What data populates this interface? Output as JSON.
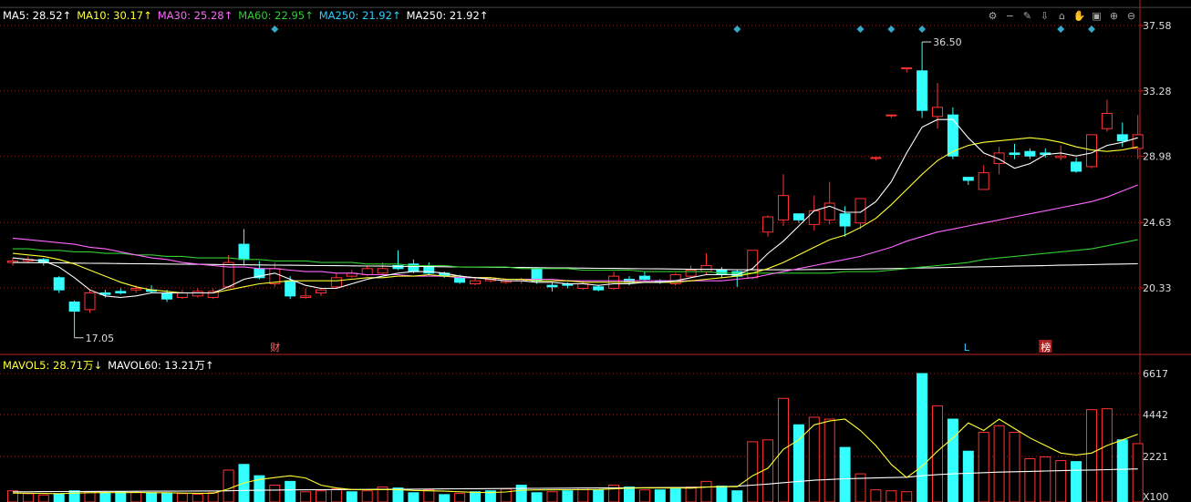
{
  "ma_legend": [
    {
      "text": "MA5: 28.52↑",
      "color": "#ffffff"
    },
    {
      "text": "MA10: 30.17↑",
      "color": "#ffff33"
    },
    {
      "text": "MA30: 25.28↑",
      "color": "#ff66ff"
    },
    {
      "text": "MA60: 22.95↑",
      "color": "#33cc33"
    },
    {
      "text": "MA250: 21.92↑",
      "color": "#33ccff"
    },
    {
      "text": "MA250: 21.92↑",
      "color": "#ffffff"
    }
  ],
  "vol_legend": [
    {
      "text": "MAVOL5: 28.71万↓",
      "color": "#ffff33"
    },
    {
      "text": "MAVOL60: 13.21万↑",
      "color": "#ffffff"
    }
  ],
  "toolbar_icons": [
    "settings-icon",
    "minus-icon",
    "brush-icon",
    "download-icon",
    "home-icon",
    "hand-icon",
    "lock-icon",
    "zoom-in-icon",
    "zoom-out-icon"
  ],
  "toolbar_glyphs": [
    "⚙",
    "−",
    "✎",
    "⇩",
    "⌂",
    "✋",
    "▣",
    "⊕",
    "⊖"
  ],
  "chart_data": {
    "type": "candlestick",
    "price_axis": {
      "ticks": [
        "37.58",
        "33.28",
        "28.98",
        "24.63",
        "20.33"
      ],
      "ylim": [
        17.0,
        37.58
      ]
    },
    "volume_axis": {
      "ticks": [
        "6617",
        "4442",
        "2221"
      ],
      "unit_label": "X100",
      "ylim": [
        0,
        7000
      ]
    },
    "annotations": {
      "high": "36.50",
      "low": "17.05"
    },
    "markers": [
      {
        "label": "财",
        "x_index": 17,
        "color": "#ff6666",
        "boxed": false
      },
      {
        "label": "L",
        "x_index": 62,
        "color": "#33ccff",
        "boxed": false
      },
      {
        "label": "榜",
        "x_index": 67,
        "color": "#ffffff",
        "boxed": true
      }
    ],
    "diamond_markers_x_index": [
      17,
      47,
      55,
      57,
      59,
      68,
      70
    ],
    "colors": {
      "up": "#ff3333",
      "down": "#33ffff",
      "ma5": "#ffffff",
      "ma10": "#ffff33",
      "ma30": "#ff66ff",
      "ma60": "#33cc33",
      "ma250": "#ffffff",
      "vol_ma5": "#ffff33",
      "vol_ma60": "#ffffff"
    },
    "candles": [
      [
        22.0,
        22.1,
        21.8,
        22.3
      ],
      [
        22.1,
        22.2,
        22.0,
        22.4
      ],
      [
        22.2,
        22.0,
        21.8,
        22.3
      ],
      [
        21.0,
        20.2,
        20.0,
        21.1
      ],
      [
        19.4,
        18.8,
        17.05,
        19.5
      ],
      [
        18.9,
        20.0,
        18.7,
        20.2
      ],
      [
        20.0,
        19.9,
        19.7,
        20.2
      ],
      [
        20.1,
        20.0,
        19.9,
        20.3
      ],
      [
        20.2,
        20.3,
        20.0,
        20.5
      ],
      [
        20.2,
        20.1,
        20.0,
        20.5
      ],
      [
        20.0,
        19.6,
        19.4,
        20.2
      ],
      [
        19.7,
        20.0,
        19.6,
        20.2
      ],
      [
        19.8,
        20.1,
        19.7,
        20.3
      ],
      [
        19.7,
        20.1,
        19.6,
        20.3
      ],
      [
        20.4,
        22.0,
        20.3,
        22.5
      ],
      [
        23.2,
        22.2,
        21.8,
        24.2
      ],
      [
        21.6,
        21.0,
        20.9,
        22.1
      ],
      [
        20.6,
        21.6,
        20.4,
        22.0
      ],
      [
        20.8,
        19.8,
        19.6,
        21.1
      ],
      [
        19.7,
        19.8,
        19.6,
        20.3
      ],
      [
        20.0,
        20.2,
        19.8,
        20.3
      ],
      [
        20.4,
        21.0,
        20.3,
        21.3
      ],
      [
        21.1,
        21.3,
        21.0,
        21.5
      ],
      [
        21.2,
        21.6,
        21.1,
        21.8
      ],
      [
        21.3,
        21.6,
        21.2,
        22.0
      ],
      [
        21.8,
        21.6,
        21.5,
        22.8
      ],
      [
        21.9,
        21.4,
        21.3,
        22.2
      ],
      [
        21.8,
        21.3,
        21.2,
        22.0
      ],
      [
        21.3,
        21.1,
        21.0,
        21.4
      ],
      [
        21.0,
        20.7,
        20.6,
        21.2
      ],
      [
        20.6,
        20.8,
        20.5,
        21.0
      ],
      [
        20.8,
        20.9,
        20.7,
        21.0
      ],
      [
        20.7,
        20.8,
        20.6,
        20.9
      ],
      [
        20.8,
        20.9,
        20.6,
        21.0
      ],
      [
        21.6,
        20.8,
        20.6,
        21.7
      ],
      [
        20.5,
        20.4,
        20.1,
        20.7
      ],
      [
        20.6,
        20.5,
        20.3,
        20.7
      ],
      [
        20.3,
        20.6,
        20.2,
        20.8
      ],
      [
        20.4,
        20.2,
        20.1,
        20.5
      ],
      [
        20.3,
        21.1,
        20.2,
        21.4
      ],
      [
        20.9,
        20.7,
        20.5,
        21.1
      ],
      [
        21.1,
        20.9,
        20.8,
        21.4
      ],
      [
        20.8,
        20.7,
        20.6,
        20.9
      ],
      [
        20.6,
        21.2,
        20.5,
        21.3
      ],
      [
        21.1,
        21.5,
        21.0,
        21.8
      ],
      [
        21.4,
        21.8,
        21.2,
        22.6
      ],
      [
        21.5,
        21.2,
        21.0,
        21.7
      ],
      [
        21.4,
        21.1,
        20.4,
        21.5
      ],
      [
        21.0,
        22.8,
        20.9,
        22.8
      ],
      [
        24.0,
        25.0,
        23.7,
        25.1
      ],
      [
        24.8,
        26.4,
        24.4,
        27.8
      ],
      [
        25.2,
        24.8,
        24.6,
        25.2
      ],
      [
        24.5,
        25.4,
        24.1,
        26.4
      ],
      [
        24.8,
        25.9,
        24.5,
        27.3
      ],
      [
        25.2,
        24.4,
        23.7,
        25.7
      ],
      [
        24.6,
        26.2,
        24.2,
        26.2
      ],
      [
        28.9,
        28.9,
        28.7,
        28.9
      ],
      [
        31.7,
        31.7,
        31.5,
        31.7
      ],
      [
        34.8,
        34.8,
        34.5,
        34.8
      ],
      [
        34.6,
        32.0,
        31.5,
        36.5
      ],
      [
        31.6,
        32.2,
        30.8,
        33.8
      ],
      [
        31.7,
        29.0,
        28.8,
        32.2
      ],
      [
        27.6,
        27.4,
        27.1,
        27.6
      ],
      [
        26.8,
        27.9,
        26.8,
        28.4
      ],
      [
        28.5,
        29.2,
        27.8,
        29.6
      ],
      [
        29.2,
        29.1,
        28.8,
        29.8
      ],
      [
        29.3,
        29.0,
        28.8,
        29.5
      ],
      [
        29.2,
        29.1,
        28.9,
        29.5
      ],
      [
        28.9,
        29.0,
        28.7,
        29.7
      ],
      [
        28.6,
        28.0,
        27.9,
        28.9
      ],
      [
        28.3,
        30.4,
        28.2,
        30.4
      ],
      [
        30.8,
        31.8,
        30.6,
        32.7
      ],
      [
        30.4,
        30.0,
        29.6,
        31.2
      ],
      [
        29.5,
        30.4,
        28.8,
        31.7
      ]
    ],
    "volume": [
      [
        400,
        1
      ],
      [
        250,
        1
      ],
      [
        180,
        1
      ],
      [
        220,
        0
      ],
      [
        400,
        0
      ],
      [
        350,
        1
      ],
      [
        280,
        0
      ],
      [
        350,
        0
      ],
      [
        320,
        1
      ],
      [
        300,
        0
      ],
      [
        280,
        0
      ],
      [
        250,
        1
      ],
      [
        220,
        1
      ],
      [
        300,
        1
      ],
      [
        1500,
        1
      ],
      [
        1800,
        0
      ],
      [
        1200,
        0
      ],
      [
        700,
        1
      ],
      [
        900,
        0
      ],
      [
        350,
        1
      ],
      [
        400,
        1
      ],
      [
        500,
        1
      ],
      [
        350,
        0
      ],
      [
        400,
        1
      ],
      [
        600,
        1
      ],
      [
        550,
        0
      ],
      [
        300,
        0
      ],
      [
        450,
        1
      ],
      [
        200,
        0
      ],
      [
        260,
        1
      ],
      [
        350,
        0
      ],
      [
        400,
        0
      ],
      [
        500,
        1
      ],
      [
        700,
        0
      ],
      [
        300,
        0
      ],
      [
        350,
        1
      ],
      [
        400,
        0
      ],
      [
        550,
        1
      ],
      [
        450,
        0
      ],
      [
        700,
        1
      ],
      [
        600,
        0
      ],
      [
        450,
        1
      ],
      [
        450,
        0
      ],
      [
        500,
        0
      ],
      [
        600,
        1
      ],
      [
        900,
        1
      ],
      [
        650,
        0
      ],
      [
        400,
        0
      ],
      [
        3000,
        1
      ],
      [
        3100,
        1
      ],
      [
        5300,
        1
      ],
      [
        3900,
        0
      ],
      [
        4300,
        1
      ],
      [
        4200,
        1
      ],
      [
        2700,
        0
      ],
      [
        1300,
        1
      ],
      [
        450,
        1
      ],
      [
        400,
        1
      ],
      [
        350,
        1
      ],
      [
        6617,
        0
      ],
      [
        4900,
        1
      ],
      [
        4200,
        0
      ],
      [
        2500,
        0
      ],
      [
        3500,
        1
      ],
      [
        3850,
        1
      ],
      [
        3500,
        1
      ],
      [
        2100,
        1
      ],
      [
        2200,
        1
      ],
      [
        2000,
        1
      ],
      [
        1950,
        0
      ],
      [
        4700,
        1
      ],
      [
        4750,
        1
      ],
      [
        3100,
        0
      ],
      [
        2900,
        1
      ]
    ],
    "ma5": [
      22.3,
      22.2,
      22.1,
      21.7,
      21.0,
      20.2,
      19.8,
      19.7,
      19.8,
      20.0,
      20.0,
      20.0,
      20.0,
      20.0,
      20.4,
      20.9,
      21.1,
      21.3,
      20.9,
      20.5,
      20.3,
      20.3,
      20.6,
      20.9,
      21.1,
      21.3,
      21.4,
      21.4,
      21.3,
      21.1,
      21.0,
      20.9,
      20.8,
      20.8,
      20.7,
      20.7,
      20.6,
      20.6,
      20.5,
      20.6,
      20.6,
      20.7,
      20.7,
      20.8,
      21.0,
      21.2,
      21.2,
      21.2,
      21.6,
      22.6,
      23.4,
      24.4,
      25.4,
      25.7,
      25.3,
      25.3,
      26.0,
      27.3,
      29.2,
      30.9,
      31.4,
      31.4,
      30.2,
      29.2,
      28.8,
      28.2,
      28.5,
      29.1,
      29.2,
      29.0,
      29.2,
      29.7,
      29.9,
      30.2
    ],
    "ma10": [
      22.6,
      22.5,
      22.4,
      22.2,
      21.9,
      21.5,
      21.1,
      20.7,
      20.4,
      20.2,
      20.1,
      20.0,
      20.0,
      20.0,
      20.2,
      20.4,
      20.6,
      20.7,
      20.8,
      20.8,
      20.8,
      20.8,
      20.9,
      21.0,
      21.0,
      21.1,
      21.1,
      21.2,
      21.1,
      21.1,
      21.0,
      21.0,
      20.9,
      20.9,
      20.8,
      20.8,
      20.8,
      20.7,
      20.7,
      20.7,
      20.7,
      20.7,
      20.7,
      20.7,
      20.8,
      20.9,
      21.0,
      21.1,
      21.3,
      21.6,
      22.0,
      22.5,
      23.0,
      23.5,
      23.8,
      24.3,
      24.9,
      25.8,
      26.8,
      27.8,
      28.7,
      29.3,
      29.7,
      29.9,
      30.0,
      30.1,
      30.2,
      30.1,
      29.9,
      29.6,
      29.4,
      29.3,
      29.4,
      29.6
    ],
    "ma30": [
      23.6,
      23.5,
      23.4,
      23.3,
      23.2,
      23.0,
      22.9,
      22.7,
      22.5,
      22.3,
      22.2,
      22.0,
      21.9,
      21.8,
      21.7,
      21.7,
      21.6,
      21.6,
      21.5,
      21.4,
      21.4,
      21.3,
      21.3,
      21.2,
      21.2,
      21.2,
      21.1,
      21.1,
      21.1,
      21.0,
      21.0,
      21.0,
      20.9,
      20.9,
      20.9,
      20.9,
      20.8,
      20.8,
      20.8,
      20.8,
      20.8,
      20.8,
      20.8,
      20.8,
      20.8,
      20.8,
      20.8,
      20.9,
      21.0,
      21.2,
      21.4,
      21.6,
      21.8,
      22.0,
      22.2,
      22.4,
      22.7,
      23.0,
      23.4,
      23.7,
      24.0,
      24.2,
      24.4,
      24.6,
      24.8,
      25.0,
      25.2,
      25.4,
      25.6,
      25.8,
      26.0,
      26.3,
      26.7,
      27.1
    ],
    "ma60": [
      22.9,
      22.9,
      22.8,
      22.8,
      22.7,
      22.7,
      22.6,
      22.6,
      22.5,
      22.5,
      22.4,
      22.4,
      22.3,
      22.3,
      22.3,
      22.2,
      22.2,
      22.1,
      22.1,
      22.1,
      22.0,
      22.0,
      22.0,
      21.9,
      21.9,
      21.9,
      21.8,
      21.8,
      21.8,
      21.7,
      21.7,
      21.7,
      21.7,
      21.6,
      21.6,
      21.6,
      21.6,
      21.5,
      21.5,
      21.5,
      21.5,
      21.4,
      21.4,
      21.4,
      21.4,
      21.4,
      21.3,
      21.3,
      21.3,
      21.3,
      21.3,
      21.3,
      21.3,
      21.3,
      21.4,
      21.4,
      21.4,
      21.5,
      21.6,
      21.7,
      21.8,
      21.9,
      22.0,
      22.2,
      22.3,
      22.4,
      22.5,
      22.6,
      22.7,
      22.8,
      22.9,
      23.1,
      23.3,
      23.5
    ],
    "ma250": [
      22.0,
      21.99,
      21.98,
      21.97,
      21.96,
      21.95,
      21.94,
      21.93,
      21.92,
      21.91,
      21.9,
      21.89,
      21.88,
      21.87,
      21.86,
      21.85,
      21.84,
      21.83,
      21.82,
      21.81,
      21.8,
      21.79,
      21.78,
      21.77,
      21.76,
      21.75,
      21.74,
      21.73,
      21.72,
      21.71,
      21.7,
      21.69,
      21.68,
      21.67,
      21.66,
      21.65,
      21.64,
      21.63,
      21.62,
      21.61,
      21.6,
      21.59,
      21.58,
      21.57,
      21.56,
      21.55,
      21.54,
      21.53,
      21.52,
      21.52,
      21.52,
      21.53,
      21.54,
      21.55,
      21.56,
      21.57,
      21.58,
      21.6,
      21.62,
      21.64,
      21.66,
      21.68,
      21.7,
      21.72,
      21.74,
      21.76,
      21.78,
      21.8,
      21.82,
      21.84,
      21.86,
      21.88,
      21.9,
      21.92
    ],
    "vol_ma5": [
      280,
      270,
      260,
      250,
      280,
      300,
      310,
      300,
      320,
      300,
      300,
      280,
      270,
      270,
      500,
      820,
      1000,
      1100,
      1200,
      1080,
      700,
      550,
      470,
      460,
      470,
      460,
      420,
      400,
      380,
      350,
      320,
      310,
      340,
      430,
      450,
      450,
      460,
      460,
      470,
      500,
      540,
      560,
      550,
      560,
      540,
      600,
      620,
      620,
      1200,
      1600,
      2600,
      3100,
      3900,
      4100,
      4200,
      3600,
      2800,
      1800,
      1100,
      1700,
      2500,
      3200,
      4000,
      3600,
      4200,
      3700,
      3200,
      2800,
      2400,
      2300,
      2400,
      2800,
      3100,
      3400
    ],
    "vol_ma60": [
      350,
      350,
      355,
      360,
      360,
      365,
      370,
      370,
      375,
      380,
      380,
      385,
      390,
      390,
      400,
      420,
      430,
      440,
      450,
      455,
      460,
      465,
      470,
      475,
      480,
      485,
      490,
      495,
      500,
      505,
      510,
      515,
      520,
      525,
      530,
      535,
      540,
      545,
      550,
      555,
      560,
      565,
      570,
      575,
      580,
      600,
      620,
      640,
      700,
      760,
      830,
      900,
      960,
      1000,
      1040,
      1060,
      1080,
      1100,
      1120,
      1200,
      1260,
      1300,
      1330,
      1360,
      1390,
      1410,
      1430,
      1450,
      1470,
      1490,
      1500,
      1520,
      1540,
      1560
    ]
  }
}
